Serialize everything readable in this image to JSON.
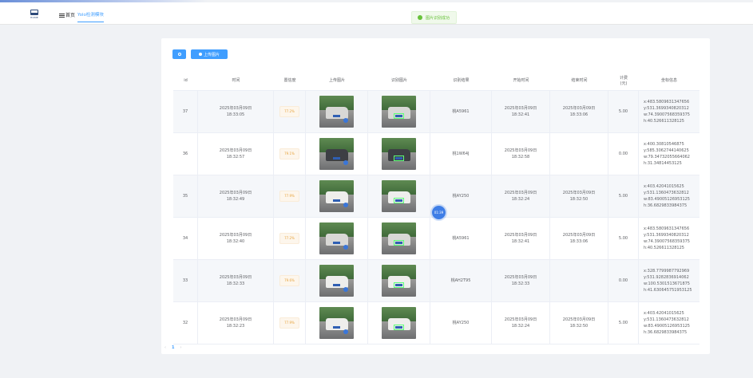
{
  "brand": {
    "logo_text": "HOME"
  },
  "nav": {
    "home_tab": "首页",
    "module_tab": "Yolo检测模块"
  },
  "toast": {
    "message": "图片识别成功"
  },
  "toolbar": {
    "search_label": "",
    "upload_label": "上传图片"
  },
  "table": {
    "headers": [
      "id",
      "时间",
      "置信度",
      "上传图片",
      "识别图片",
      "识别结果",
      "开始时间",
      "结束时间",
      "计费\n(元)",
      "坐标信息"
    ],
    "rows": [
      {
        "id": "37",
        "time": "2025年03月09日\n18:33:05",
        "confidence": "77.2%",
        "result": "桃A5961",
        "start": "2025年03月09日\n18:32:41",
        "end": "2025年03月09日\n18:33:06",
        "fee": "5.00",
        "coords": "x:483.5809631347656\ny:531.3699340820312\nw:74.39007568359375\nh:40.526611328125"
      },
      {
        "id": "36",
        "time": "2025年03月09日\n18:32:57",
        "confidence": "79.1%",
        "result": "桃1W64J",
        "start": "2025年03月09日\n18:32:58",
        "end": "",
        "fee": "0.00",
        "coords": "x:400.30810546875\ny:585.3062744140625\nw:79.34732055664062\nh:31.34814453125"
      },
      {
        "id": "35",
        "time": "2025年03月09日\n18:32:49",
        "confidence": "77.9%",
        "result": "桃AY250",
        "start": "2025年03月09日\n18:32:24",
        "end": "2025年03月09日\n18:32:50",
        "fee": "5.00",
        "coords": "x:403.42041015625\ny:531.1360473632812\nw:83.49005126953125\nh:36.6829833984375"
      },
      {
        "id": "34",
        "time": "2025年03月09日\n18:32:40",
        "confidence": "77.2%",
        "result": "桃A5961",
        "start": "2025年03月09日\n18:32:41",
        "end": "2025年03月09日\n18:33:06",
        "fee": "5.00",
        "coords": "x:483.5809631347656\ny:531.3699340820312\nw:74.39007568359375\nh:40.526611328125"
      },
      {
        "id": "33",
        "time": "2025年03月09日\n18:32:33",
        "confidence": "79.6%",
        "result": "桃AH2T95",
        "start": "2025年03月09日\n18:32:33",
        "end": "",
        "fee": "0.00",
        "coords": "x:328.7799987792969\ny:531.9282836914062\nw:100.5301513671875\nh:41.630645751953125"
      },
      {
        "id": "32",
        "time": "2025年03月09日\n18:32:23",
        "confidence": "77.9%",
        "result": "桃AY250",
        "start": "2025年03月09日\n18:32:24",
        "end": "2025年03月09日\n18:32:50",
        "fee": "5.00",
        "coords": "x:403.42041015625\ny:531.1360473632812\nw:83.49005126953125\nh:36.6829833984375"
      }
    ]
  },
  "overlay": {
    "cursor_label": "01:39"
  },
  "pagination": {
    "prev": "‹",
    "current": "1",
    "next": "›"
  },
  "colors": {
    "primary": "#409eff",
    "success": "#67c23a",
    "warning": "#e6a23c"
  },
  "icons": [
    "home-logo-icon",
    "menu-icon",
    "check-circle-icon",
    "search-icon",
    "upload-icon"
  ]
}
